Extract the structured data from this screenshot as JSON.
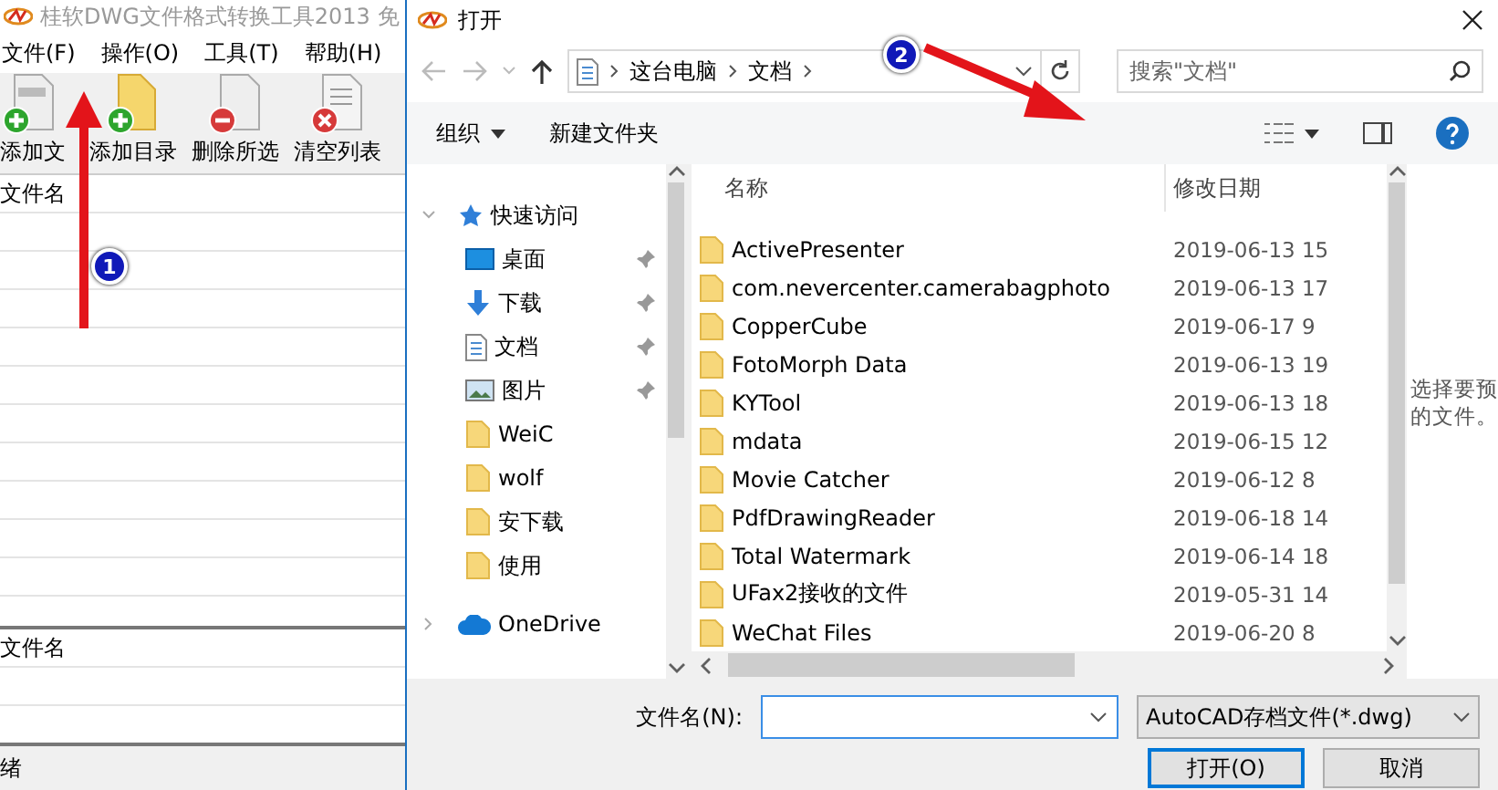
{
  "main_window": {
    "title": "桂软DWG文件格式转换工具2013 免",
    "menu": [
      "文件(F)",
      "操作(O)",
      "工具(T)",
      "帮助(H)"
    ],
    "toolbar": [
      {
        "kind": "add-file",
        "label": "添加文"
      },
      {
        "kind": "add-folder",
        "label": "添加目录"
      },
      {
        "kind": "delete",
        "label": "删除所选"
      },
      {
        "kind": "clear",
        "label": "清空列表"
      }
    ],
    "file_list": {
      "column_1": "文件名"
    },
    "output_list": {
      "column_1": "文件名"
    },
    "status_bar": "绪"
  },
  "dialog": {
    "title": "打开",
    "breadcrumb": [
      "这台电脑",
      "文档"
    ],
    "search": {
      "placeholder": "搜索\"文档\""
    },
    "commands": [
      {
        "label": "组织",
        "dropdown": true
      },
      {
        "label": "新建文件夹",
        "dropdown": false
      }
    ],
    "nav_items": [
      {
        "kind": "star",
        "label": "快速访问",
        "pinned": false,
        "expanded": true
      },
      {
        "kind": "desktop",
        "label": "桌面",
        "pinned": true
      },
      {
        "kind": "download",
        "label": "下载",
        "pinned": true
      },
      {
        "kind": "document",
        "label": "文档",
        "pinned": true
      },
      {
        "kind": "picture",
        "label": "图片",
        "pinned": true
      },
      {
        "kind": "folder",
        "label": "WeiC",
        "pinned": false
      },
      {
        "kind": "folder",
        "label": "wolf",
        "pinned": false
      },
      {
        "kind": "folder",
        "label": "安下载",
        "pinned": false
      },
      {
        "kind": "folder",
        "label": "使用",
        "pinned": false
      },
      {
        "kind": "cloud",
        "label": "OneDrive",
        "pinned": false,
        "expanded": false
      }
    ],
    "columns": [
      "名称",
      "修改日期"
    ],
    "files": [
      {
        "name": "ActivePresenter",
        "date": "2019-06-13 15"
      },
      {
        "name": "com.nevercenter.camerabagphoto",
        "date": "2019-06-13 17"
      },
      {
        "name": "CopperCube",
        "date": "2019-06-17 9"
      },
      {
        "name": "FotoMorph Data",
        "date": "2019-06-13 19"
      },
      {
        "name": "KYTool",
        "date": "2019-06-13 18"
      },
      {
        "name": "mdata",
        "date": "2019-06-15 12"
      },
      {
        "name": "Movie Catcher",
        "date": "2019-06-12 8"
      },
      {
        "name": "PdfDrawingReader",
        "date": "2019-06-18 14"
      },
      {
        "name": "Total Watermark",
        "date": "2019-06-14 18"
      },
      {
        "name": "UFax2接收的文件",
        "date": "2019-05-31 14"
      },
      {
        "name": "WeChat Files",
        "date": "2019-06-20 8"
      }
    ],
    "preview_text": [
      "选择要预",
      "的文件。"
    ],
    "filename_label": "文件名(N):",
    "file_type": "AutoCAD存档文件(*.dwg)",
    "buttons": [
      {
        "label": "打开(O)",
        "default": true
      },
      {
        "label": "取消",
        "default": false
      }
    ]
  },
  "annotations": [
    {
      "label": "1"
    },
    {
      "label": "2"
    }
  ]
}
